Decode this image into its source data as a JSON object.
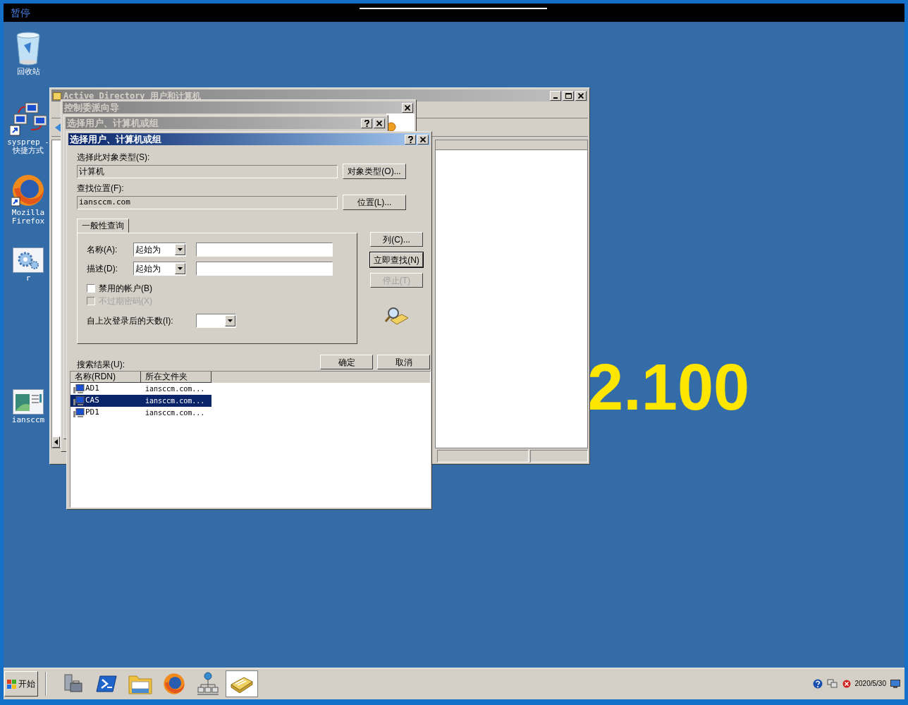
{
  "vm_bar": {
    "label": "暂停"
  },
  "desktop_icons": [
    {
      "kind": "recycle-bin",
      "label": "回收站"
    },
    {
      "kind": "network-shortcut",
      "label": "sysprep - 快捷方式"
    },
    {
      "kind": "firefox",
      "label": "Mozilla Firefox"
    },
    {
      "kind": "gear-window",
      "label": "r"
    },
    {
      "kind": "app-window",
      "label": "iansccm"
    }
  ],
  "wallpaper_text": "2.100",
  "ad_window": {
    "title": "Active Directory 用户和计算机"
  },
  "wizard": {
    "title": "控制委派向导"
  },
  "back_dialog": {
    "title": "选择用户、计算机或组"
  },
  "dialog": {
    "title": "选择用户、计算机或组",
    "object_type_label": "选择此对象类型(S):",
    "object_type_value": "计算机",
    "object_type_button": "对象类型(O)...",
    "location_label": "查找位置(F):",
    "location_value": "iansccm.com",
    "location_button": "位置(L)...",
    "tab": "一般性查询",
    "name_label": "名称(A):",
    "name_mode": "起始为",
    "desc_label": "描述(D):",
    "desc_mode": "起始为",
    "checkboxes": [
      {
        "label": "禁用的帐户(B)",
        "checked": false,
        "disabled": false
      },
      {
        "label": "不过期密码(X)",
        "checked": false,
        "disabled": true
      }
    ],
    "days_label": "自上次登录后的天数(I):",
    "side_buttons": [
      {
        "label": "列(C)...",
        "default": false,
        "disabled": false
      },
      {
        "label": "立即查找(N)",
        "default": true,
        "disabled": false
      },
      {
        "label": "停止(T)",
        "default": false,
        "disabled": true
      }
    ],
    "ok": "确定",
    "cancel": "取消",
    "results_label": "搜索结果(U):",
    "columns": [
      "名称(RDN)",
      "所在文件夹"
    ],
    "rows": [
      {
        "name": "AD1",
        "folder": "iansccm.com...",
        "selected": false
      },
      {
        "name": "CAS",
        "folder": "iansccm.com...",
        "selected": true
      },
      {
        "name": "PD1",
        "folder": "iansccm.com...",
        "selected": false
      }
    ]
  },
  "taskbar": {
    "start": "开始",
    "apps": [
      {
        "kind": "server-manager",
        "active": false
      },
      {
        "kind": "powershell",
        "active": false
      },
      {
        "kind": "folder",
        "active": false
      },
      {
        "kind": "firefox",
        "active": false
      },
      {
        "kind": "network",
        "active": false
      },
      {
        "kind": "directory",
        "active": true
      }
    ],
    "clock": "2020/5/30"
  }
}
